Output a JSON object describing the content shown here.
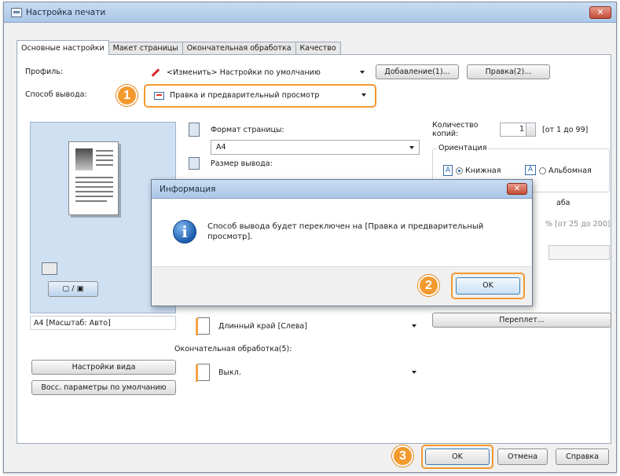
{
  "window": {
    "title": "Настройка печати"
  },
  "tabs": [
    {
      "label": "Основные настройки",
      "active": true
    },
    {
      "label": "Макет страницы",
      "active": false
    },
    {
      "label": "Окончательная обработка",
      "active": false
    },
    {
      "label": "Качество",
      "active": false
    }
  ],
  "profile": {
    "label": "Профиль:",
    "value": "<Изменить> Настройки по умолчанию",
    "add_button": "Добавление(1)...",
    "edit_button": "Правка(2)..."
  },
  "output": {
    "label": "Способ вывода:",
    "value": "Правка и предварительный просмотр"
  },
  "preview": {
    "caption": "A4 [Масштаб: Авто]",
    "view_settings_button": "Настройки вида",
    "restore_defaults_button": "Восс. параметры по умолчанию"
  },
  "page_size": {
    "label": "Формат страницы:",
    "value": "A4"
  },
  "output_size": {
    "label": "Размер вывода:"
  },
  "copies": {
    "label": "Количество копий:",
    "value": "1",
    "range": "[от 1 до 99]"
  },
  "orientation": {
    "label": "Ориентация",
    "portrait": "Книжная",
    "landscape": "Альбомная"
  },
  "scale": {
    "label_fragment": "аба",
    "range": "% [от 25 до 200]"
  },
  "binding": {
    "value": "Длинный край [Слева]",
    "button": "Переплет..."
  },
  "finishing": {
    "label": "Окончательная обработка(5):",
    "value": "Выкл."
  },
  "footer": {
    "ok": "OK",
    "cancel": "Отмена",
    "help": "Справка"
  },
  "dialog": {
    "title": "Информация",
    "message": "Способ вывода будет переключен на [Правка и предварительный просмотр].",
    "ok": "OK"
  },
  "badges": {
    "one": "1",
    "two": "2",
    "three": "3"
  },
  "colors": {
    "accent": "#f29a2e",
    "titlebar": "#aac7e8",
    "preview_bg": "#cfe0f3"
  }
}
